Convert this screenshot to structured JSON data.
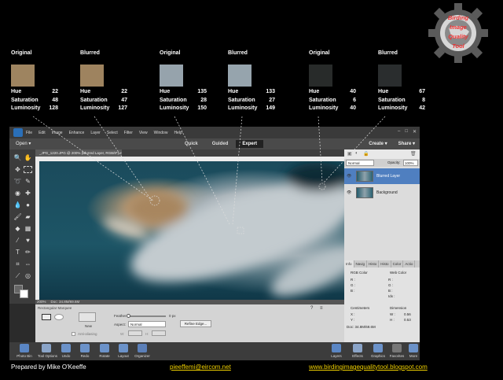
{
  "samples": [
    {
      "title": "Original",
      "swatch": "#9e8460",
      "hue": "22",
      "saturation": "48",
      "luminosity": "128"
    },
    {
      "title": "Blurred",
      "swatch": "#9e835f",
      "hue": "22",
      "saturation": "47",
      "luminosity": "127"
    },
    {
      "title": "Original",
      "swatch": "#96a3ac",
      "hue": "135",
      "saturation": "28",
      "luminosity": "150"
    },
    {
      "title": "Blurred",
      "swatch": "#96a4ad",
      "hue": "133",
      "saturation": "27",
      "luminosity": "149"
    },
    {
      "title": "Original",
      "swatch": "#282b2a",
      "hue": "40",
      "saturation": "6",
      "luminosity": "40"
    },
    {
      "title": "Blurred",
      "swatch": "#2a2d2e",
      "hue": "67",
      "saturation": "8",
      "luminosity": "42"
    }
  ],
  "labels": {
    "hue": "Hue",
    "saturation": "Saturation",
    "luminosity": "Luminosity"
  },
  "logo": {
    "line1": "Birding",
    "line2": "Image",
    "line3": "Quality",
    "line4": "Tool"
  },
  "menu": [
    "File",
    "Edit",
    "Image",
    "Enhance",
    "Layer",
    "Select",
    "Filter",
    "View",
    "Window",
    "Help"
  ],
  "modebar": {
    "open": "Open",
    "tabs": [
      "Quick",
      "Guided",
      "Expert"
    ],
    "active_tab": "Expert",
    "create": "Create",
    "share": "Share"
  },
  "document": {
    "tab": "_JPG_1220.JPG @ 200% (Blurred Layer, RGB/8*) ×",
    "zoom": "200%",
    "doc_size": "Doc: 34.8M/69.6M"
  },
  "tool_options": {
    "tool_name": "Rectangular Marquee",
    "feather_label": "Feather:",
    "feather_value": "0 px",
    "aspect_label": "Aspect:",
    "aspect_value": "Normal",
    "new_label": "New",
    "anti_alias_label": "Anti-aliasing",
    "refine_button": "Refine Edge..."
  },
  "layers": {
    "blend_mode": "Normal",
    "opacity_label": "Opacity:",
    "opacity_value": "100%",
    "items": [
      {
        "name": "Blurred Layer",
        "selected": true
      },
      {
        "name": "Background",
        "selected": false
      }
    ]
  },
  "info": {
    "tabs": [
      "Info",
      "Navig",
      "Histo",
      "Histo",
      "Color",
      "Actio"
    ],
    "rgb_label": "RGB Color",
    "web_label": "Web Color",
    "r": "R :",
    "g": "G :",
    "b": "B :",
    "idx": "Idx :",
    "units": "Centimeters",
    "dimension": "Dimension",
    "x": "X :",
    "y": "Y :",
    "w": "W :",
    "h": "H :",
    "w_value": "0.56",
    "h_value": "0.53",
    "doc": "Doc: 34.8M/69.6M"
  },
  "taskbar": {
    "left": [
      "Photo Bin",
      "Tool Options",
      "Undo",
      "Redo",
      "Rotate",
      "Layout",
      "Organizer"
    ],
    "right": [
      "Layers",
      "Effects",
      "Graphics",
      "Favorites",
      "More"
    ]
  },
  "footer": {
    "credit": "Prepared by Mike O'Keeffe",
    "email": "pieeffemi@eircom.net",
    "website": "www.birdingimagequalitytool.blogspot.com"
  }
}
